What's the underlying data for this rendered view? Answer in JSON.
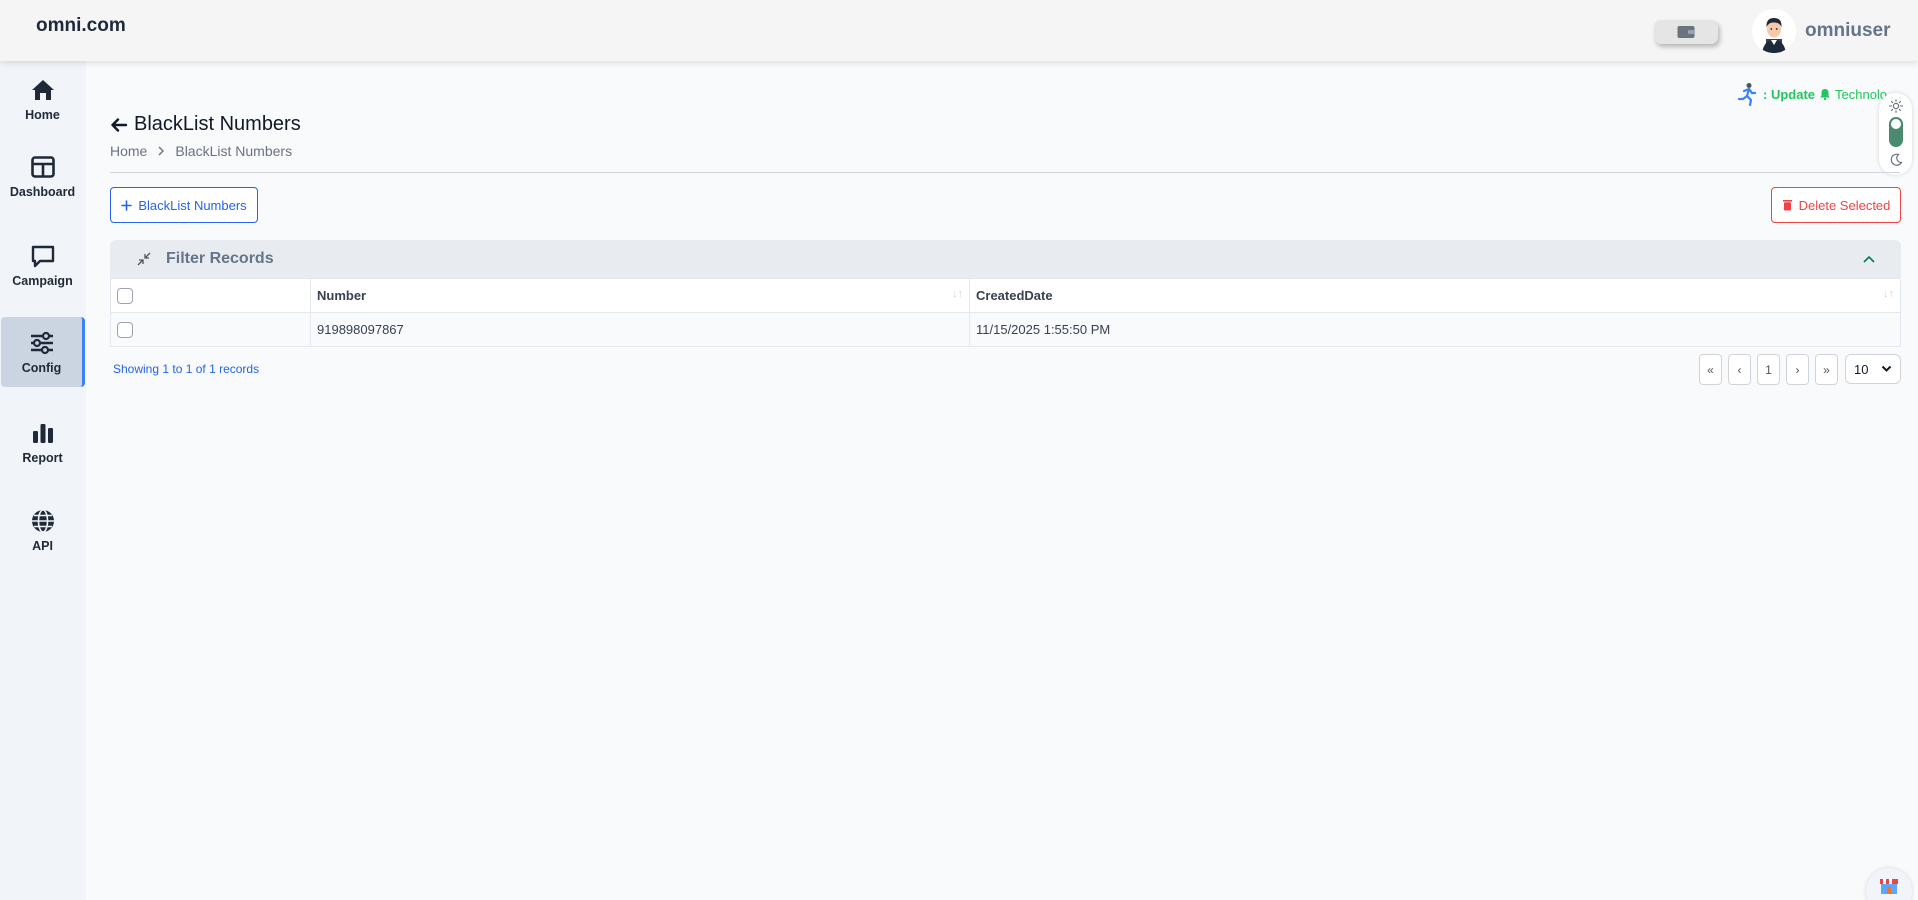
{
  "header": {
    "brand": "omni.com",
    "username": "omniuser"
  },
  "sidebar": {
    "items": [
      {
        "label": "Home",
        "icon": "home-icon"
      },
      {
        "label": "Dashboard",
        "icon": "dashboard-icon"
      },
      {
        "label": "Campaign",
        "icon": "chat-icon"
      },
      {
        "label": "Config",
        "icon": "sliders-icon",
        "active": true
      },
      {
        "label": "Report",
        "icon": "bar-chart-icon"
      },
      {
        "label": "API",
        "icon": "globe-icon"
      }
    ]
  },
  "ticker": {
    "prefix": ": Update",
    "text": "Technolo"
  },
  "page": {
    "title": "BlackList Numbers",
    "breadcrumb": [
      "Home",
      "BlackList Numbers"
    ]
  },
  "toolbar": {
    "add_label": "BlackList Numbers",
    "delete_label": "Delete Selected"
  },
  "filter": {
    "title": "Filter Records"
  },
  "table": {
    "columns": [
      "Number",
      "CreatedDate"
    ],
    "rows": [
      {
        "number": "919898097867",
        "created": "11/15/2025 1:55:50 PM"
      }
    ]
  },
  "pagination": {
    "info": "Showing 1 to 1 of 1 records",
    "first": "«",
    "prev": "‹",
    "current": "1",
    "next": "›",
    "last": "»",
    "page_size": "10"
  },
  "colors": {
    "accent": "#2563eb",
    "danger": "#ef4444",
    "ticker": "#22c55e"
  }
}
